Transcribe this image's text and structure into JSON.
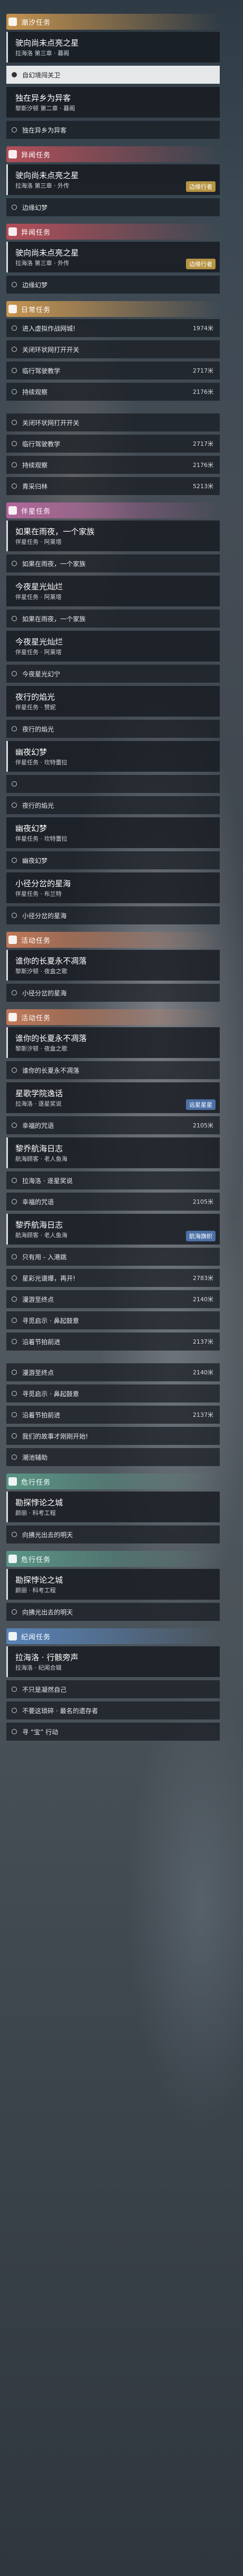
{
  "screen_title": "",
  "categories": {
    "dream": "潮汐任务",
    "side": "异闻任务",
    "daily": "日常任务",
    "companion": "伴星任务",
    "event": "活动任务",
    "trial": "危行任务",
    "record": "纪闻任务"
  },
  "tags": {
    "edge": "边缘行者",
    "voyage": "远星星星",
    "sail": "航海旗帜"
  },
  "items": {
    "q1_title": "驶向尚未点亮之星",
    "q1_sub": "拉海洛 第三章 · 暮阁",
    "q1_sel": "自幻境闯关卫",
    "q2_title": "独在异乡为异客",
    "q2_sub": "黎斯汐顿 第二章 · 暮阁",
    "q2_row": "独在异乡为异客",
    "q3_title": "驶向尚未点亮之星",
    "q3_sub": "拉海洛 第三章 · 外传",
    "q3_row": "边缘幻梦",
    "q4_title": "驶向尚未点亮之星",
    "q4_sub": "拉海洛 第三章 · 外传",
    "q4_row": "边缘幻梦",
    "d1": "进入虚拟作战网城!",
    "d1_dist": "1974米",
    "d2": "关闭环状网打开开关",
    "d3": "临行驾驶教学",
    "d3_dist": "2717米",
    "d4": "持续观察",
    "d4_dist": "2176米",
    "d5": "关闭环状网打开开关",
    "d6": "临行驾驶教学",
    "d6_dist": "2717米",
    "d7": "持续观察",
    "d7_dist": "2176米",
    "d8": "青采归林",
    "d8_dist": "5213米",
    "c1_title": "如果在雨夜，一个家族",
    "c1_sub": "伴星任务 · 阿莱塔",
    "c1_row": "如果在雨夜，一个家族",
    "c2_title": "今夜星光灿烂",
    "c2_sub": "伴星任务 · 阿莱塔",
    "c2_row": "如果在雨夜，一个家族",
    "c3_title": "今夜星光灿烂",
    "c3_sub": "伴星任务 · 阿莱塔",
    "c3_row": "今夜星光幻宁",
    "c4_title": "夜行的焰光",
    "c4_sub": "伴星任务 · 赞妮",
    "c4_row": "夜行的焰光",
    "c5_title": "幽夜幻梦",
    "c5_sub": "伴星任务 · 坎特蕾拉",
    "c5_row1": "",
    "c5_row2": "夜行的焰光",
    "c6_title": "幽夜幻梦",
    "c6_sub": "伴星任务 · 坎特蕾拉",
    "c6_row": "幽夜幻梦",
    "c7_title": "小径分岔的星海",
    "c7_sub": "伴星任务 · 布兰特",
    "c7_row": "小径分岔的星海",
    "e1_title": "谁你的长夏永不凋落",
    "e1_sub": "黎斯汐顿 · 夜盒之歌",
    "e1_row": "小径分岔的星海",
    "e2_title": "谁你的长夏永不凋落",
    "e2_sub": "黎斯汐顿 · 夜盒之歌",
    "e2_row": "谁你的长夏永不凋落",
    "e3_title": "星歌学院逸话",
    "e3_sub": "拉海洛 · 逐星奖说",
    "e3_row": "幸福的咒语",
    "e3_dist": "2105米",
    "e4_title": "黎乔航海日志",
    "e4_sub": "航海顾客 · 老人鱼海",
    "e4_row1": "拉海洛 · 逐星奖说",
    "e4_row2": "幸福的咒语",
    "e4_dist": "2105米",
    "e5_title": "黎乔航海日志",
    "e5_sub": "航海顾客 · 老人鱼海",
    "e5_r1": "只有用 - 入港跳",
    "e5_r2": "星彩光谱爆，再开!",
    "e5_r2_dist": "2783米",
    "e5_r3": "漫游至终点",
    "e5_r3_dist": "2140米",
    "e5_r4": "寻觅启示 · 鼻起鼓意",
    "e5_r5": "沿着节拍前进",
    "e5_r5_dist": "2137米",
    "e5_r6": "漫游至终点",
    "e5_r6_dist": "2140米",
    "e5_r7": "寻觅启示 · 鼻起鼓意",
    "e5_r8": "沿着节拍前进",
    "e5_r8_dist": "2137米",
    "e5_r9": "我们的故事才刚刚开始!",
    "e5_r10": "潮池辅助",
    "t1_title": "勘探悖论之城",
    "t1_sub": "颜丽 · 科考工程",
    "t1_row": "向拂光出去的明天",
    "t2_title": "勘探悖论之城",
    "t2_sub": "颜丽 · 科考工程",
    "t2_row": "向拂光出去的明天",
    "r1_title": "拉海洛 · 行骸旁声",
    "r1_sub": "拉海洛 · 纪闻合辑",
    "r1_row1": "不只是凝然自己",
    "r1_row2": "不要这琐碎 · 最名的遗存者",
    "r1_row3": "寻 “宝” 行动"
  }
}
